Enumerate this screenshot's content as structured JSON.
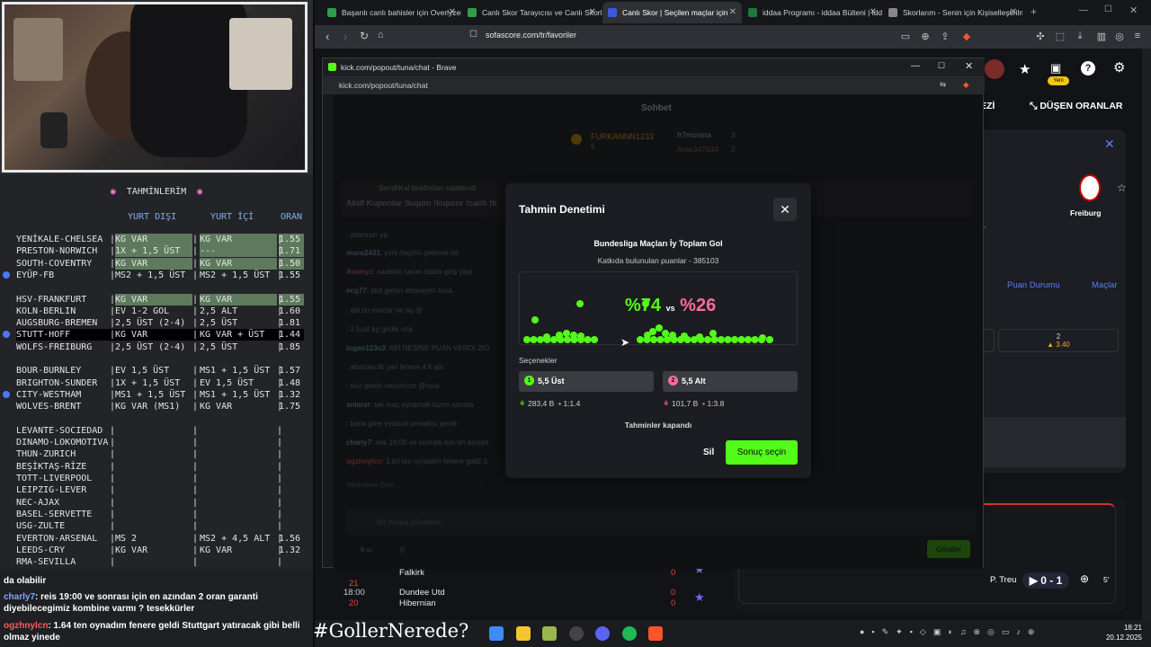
{
  "stream": {
    "table_title": "TAHMİNLERİM",
    "headers": {
      "abroad": "YURT DIŞI",
      "home": "YURT İÇİ",
      "odds": "ORAN"
    },
    "rows": [
      {
        "match": "YENİKALE-CHELSEA",
        "a": "KG VAR",
        "b": "KG VAR",
        "o": "1.55",
        "hl": true,
        "dot": false
      },
      {
        "match": "PRESTON-NORWICH",
        "a": "1X + 1,5 ÜST",
        "b": "---",
        "o": "1.71",
        "hl": true,
        "dot": false
      },
      {
        "match": "SOUTH-COVENTRY",
        "a": "KG VAR",
        "b": "KG VAR",
        "o": "1.50",
        "hl": true,
        "dot": false
      },
      {
        "match": "EYÜP-FB",
        "a": "MS2 + 1,5 ÜST",
        "b": "MS2 + 1,5 ÜST",
        "o": "1.55",
        "hl": false,
        "dot": true
      },
      {
        "match": "",
        "a": "",
        "b": "",
        "o": "",
        "hl": false,
        "dot": false
      },
      {
        "match": "HSV-FRANKFURT",
        "a": "KG VAR",
        "b": "KG VAR",
        "o": "1.55",
        "hl": true,
        "dot": false
      },
      {
        "match": "KOLN-BERLIN",
        "a": "EV 1-2 GOL",
        "b": "2,5 ALT",
        "o": "1.60",
        "hl": false,
        "dot": false
      },
      {
        "match": "AUGSBURG-BREMEN",
        "a": "2,5 ÜST (2-4)",
        "b": "2,5 ÜST",
        "o": "1.81",
        "hl": false,
        "dot": false
      },
      {
        "match": "STUTT-HOFF",
        "a": "KG VAR",
        "b": "KG VAR + ÜST",
        "o": "1.44",
        "hl": false,
        "dot": true,
        "sel": true
      },
      {
        "match": "WOLFS-FREIBURG",
        "a": "2,5 ÜST (2-4)",
        "b": "2,5 ÜST",
        "o": "1.85",
        "hl": false,
        "dot": false
      },
      {
        "match": "",
        "a": "",
        "b": "",
        "o": "",
        "hl": false,
        "dot": false
      },
      {
        "match": "BOUR-BURNLEY",
        "a": "EV 1,5 ÜST",
        "b": "MS1 + 1,5 ÜST",
        "o": "1.57",
        "hl": false,
        "dot": false
      },
      {
        "match": "BRIGHTON-SUNDER",
        "a": "1X + 1,5 ÜST",
        "b": "EV 1,5 ÜST",
        "o": "1.48",
        "hl": false,
        "dot": false
      },
      {
        "match": "CITY-WESTHAM",
        "a": "MS1 + 1,5 ÜST",
        "b": "MS1 + 1,5 ÜST",
        "o": "1.32",
        "hl": false,
        "dot": true
      },
      {
        "match": "WOLVES-BRENT",
        "a": "KG VAR (MS1)",
        "b": "KG VAR",
        "o": "1.75",
        "hl": false,
        "dot": false
      },
      {
        "match": "",
        "a": "",
        "b": "",
        "o": "",
        "hl": false,
        "dot": false
      },
      {
        "match": "LEVANTE-SOCIEDAD",
        "a": "",
        "b": "",
        "o": "",
        "hl": false,
        "dot": false
      },
      {
        "match": "DINAMO-LOKOMOTIVA",
        "a": "",
        "b": "",
        "o": "",
        "hl": false,
        "dot": false
      },
      {
        "match": "THUN-ZURICH",
        "a": "",
        "b": "",
        "o": "",
        "hl": false,
        "dot": false
      },
      {
        "match": "BEŞİKTAŞ-RİZE",
        "a": "",
        "b": "",
        "o": "",
        "hl": false,
        "dot": false
      },
      {
        "match": "TOTT-LIVERPOOL",
        "a": "",
        "b": "",
        "o": "",
        "hl": false,
        "dot": false
      },
      {
        "match": "LEIPZIG-LEVER",
        "a": "",
        "b": "",
        "o": "",
        "hl": false,
        "dot": false
      },
      {
        "match": "NEC-AJAX",
        "a": "",
        "b": "",
        "o": "",
        "hl": false,
        "dot": false
      },
      {
        "match": "BASEL-SERVETTE",
        "a": "",
        "b": "",
        "o": "",
        "hl": false,
        "dot": false
      },
      {
        "match": "USG-ZULTE",
        "a": "",
        "b": "",
        "o": "",
        "hl": false,
        "dot": false
      },
      {
        "match": "EVERTON-ARSENAL",
        "a": "MS 2",
        "b": "MS2 + 4,5 ALT",
        "o": "1.56",
        "hl": false,
        "dot": false
      },
      {
        "match": "LEEDS-CRY",
        "a": "KG VAR",
        "b": "KG VAR",
        "o": "1.32",
        "hl": false,
        "dot": false
      },
      {
        "match": "RMA-SEVILLA",
        "a": "",
        "b": "",
        "o": "",
        "hl": false,
        "dot": false
      }
    ],
    "chat": [
      {
        "user": "",
        "text": "da olabilir",
        "color": "#ffffff"
      },
      {
        "user": "charly7",
        "text": ": reis 19:00 ve sonrası için en azından 2 oran garanti diyebilecegimiz kombine varmı ? tesekkürler",
        "color": "#7fa8ff"
      },
      {
        "user": "ogzhnylcn",
        "text": ": 1.64 ten oynadım fenere geldi Stuttgart yatıracak gibi belli olmaz yinede",
        "color": "#ff5a5a"
      }
    ],
    "hashtag": "#GollerNerede?"
  },
  "browser": {
    "tabs": [
      {
        "label": "Başarılı canlı bahisler için Overlyzer",
        "color": "#2e9e4a",
        "active": false
      },
      {
        "label": "Canlı Skor Tarayıcısı ve Canlı Skorlar",
        "color": "#2e9e4a",
        "active": false
      },
      {
        "label": "Canlı Skor | Seçilen maçlar için",
        "color": "#3b5bdb",
        "active": true
      },
      {
        "label": "iddaa Programı - iddaa Bülteni | iddaa",
        "color": "#1e7a3c",
        "active": false
      },
      {
        "label": "Skorlarım - Senin için Kişiselleştirilmiş",
        "color": "#888888",
        "active": false
      }
    ],
    "url": "sofascore.com/tr/favoriler"
  },
  "sofa": {
    "menu_ezi": "EZİ",
    "menu_dusen": "DÜŞEN ORANLAR",
    "new_badge": "Yeni",
    "team": "Freiburg",
    "puan_durumu": "Puan Durumu",
    "maclar": "Maçlar",
    "odd_label": "2",
    "odd_value": "3.40",
    "side_text": "u 5'",
    "matches": [
      {
        "time": "",
        "min": "21",
        "home": "Falkirk",
        "away": "",
        "hs": "0",
        "as": ""
      },
      {
        "time": "18:00",
        "min": "20",
        "home": "Dundee Utd",
        "away": "Hibernian",
        "hs": "0",
        "as": "0"
      }
    ],
    "live": {
      "player": "P. Treu",
      "score": "0 - 1",
      "minute": "5'"
    }
  },
  "popout": {
    "title": "kick.com/popout/tuna/chat - Brave",
    "url": "kick.com/popout/tuna/chat",
    "chat_header": "Sohbet",
    "leaders": [
      {
        "name": "FURKANNN1233",
        "n": "5"
      },
      {
        "name": "fr7monsta",
        "n": "3"
      },
      {
        "name": "Aras347634",
        "n": "2"
      }
    ],
    "pinned_by": "SemihKal tarafından sabitlendi",
    "pinned": "Aktif Kuponlar !kupon !kuponr !canlı !b",
    "messages": [
      {
        "u": "",
        "t": ": adamsın ya"
      },
      {
        "u": "muro2431",
        "t": ": yeni öngörü gelecek mi"
      },
      {
        "u": "Avamyz",
        "t": ": sadettin saran stada giriş yapı"
      },
      {
        "u": "ecg77",
        "t": ": stut gelsin aboneyim tuna"
      },
      {
        "u": "",
        "t": ": abi bu maclar ne aq @"
      },
      {
        "u": "",
        "t": ": 2.5ust kg girdik ona"
      },
      {
        "u": "logan123s3",
        "t": ": ABİ NESİNE PUAN VERDİ 250"
      },
      {
        "u": "",
        "t": ": allahtan.ilk yari fenere 4 k attı"
      },
      {
        "u": "",
        "t": ": stut gelsin veriyorum @tuna"
      },
      {
        "u": "anlarar",
        "t": ": tek maç oynamak lazım asında"
      },
      {
        "u": "",
        "t": ": bana göre eyubun penaltısı yendi"
      },
      {
        "u": "charly7",
        "t": ": reis 19:00 ve sonrası için en azında"
      },
      {
        "u": "ogzhnylcn",
        "t": ": 1.64 ten oynadım fenere geldi S"
      }
    ],
    "followers_note": "Takipçilere Özel",
    "input_placeholder": "Bir mesaj gönderin",
    "send": "Gönder",
    "count": "0"
  },
  "modal": {
    "title": "Tahmin Denetimi",
    "game": "Bundesliga Maçları İy Toplam Gol",
    "contrib": "Katkıda bulunulan puanlar - 385103",
    "pct_left": "%74",
    "vs": "vs",
    "pct_right": "%26",
    "options_label": "Seçenekler",
    "options": [
      {
        "num": "1",
        "label": "5,5 Üst",
        "points": "283,4 B",
        "ratio": "1:1.4",
        "color": "#53fc18"
      },
      {
        "num": "2",
        "label": "5,5 Alt",
        "points": "101,7 B",
        "ratio": "1:3.8",
        "color": "#ff6b9a"
      }
    ],
    "closed": "Tahminler kapandı",
    "delete": "Sil",
    "select_result": "Sonuç seçin"
  },
  "taskbar": {
    "time": "18:21",
    "date": "20.12.2025"
  }
}
